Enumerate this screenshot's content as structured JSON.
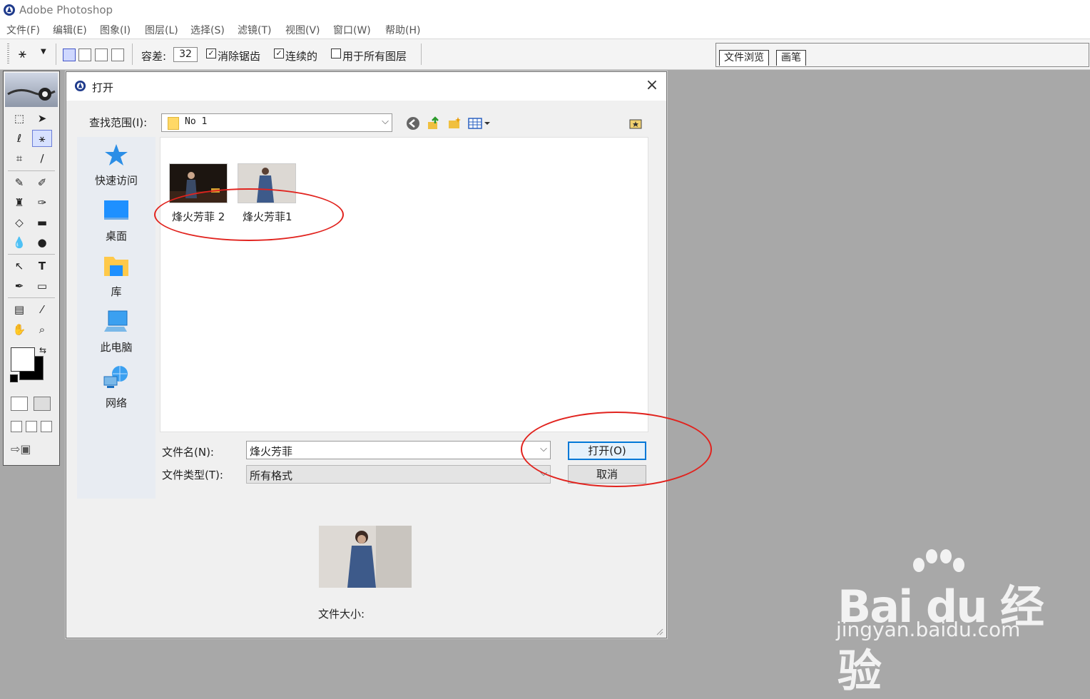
{
  "app": {
    "title": "Adobe Photoshop"
  },
  "menu": [
    {
      "label": "文件(F)"
    },
    {
      "label": "编辑(E)"
    },
    {
      "label": "图象(I)"
    },
    {
      "label": "图层(L)"
    },
    {
      "label": "选择(S)"
    },
    {
      "label": "滤镜(T)"
    },
    {
      "label": "视图(V)"
    },
    {
      "label": "窗口(W)"
    },
    {
      "label": "帮助(H)"
    }
  ],
  "options": {
    "tolerance_label": "容差:",
    "tolerance_value": "32",
    "antialias_label": "消除锯齿",
    "antialias_checked": true,
    "contiguous_label": "连续的",
    "contiguous_checked": true,
    "all_layers_label": "用于所有图层",
    "all_layers_checked": false
  },
  "palette_tabs": [
    {
      "label": "文件浏览"
    },
    {
      "label": "画笔"
    }
  ],
  "dialog": {
    "title": "打开",
    "lookin_label": "查找范围(I):",
    "lookin_value": "No 1",
    "places": [
      {
        "label": "快速访问",
        "icon": "star-icon"
      },
      {
        "label": "桌面",
        "icon": "desktop-icon"
      },
      {
        "label": "库",
        "icon": "library-folder-icon"
      },
      {
        "label": "此电脑",
        "icon": "computer-icon"
      },
      {
        "label": "网络",
        "icon": "network-icon"
      }
    ],
    "files": [
      {
        "name": "烽火芳菲 2"
      },
      {
        "name": "烽火芳菲1"
      }
    ],
    "filename_label": "文件名(N):",
    "filename_value": "烽火芳菲",
    "filetype_label": "文件类型(T):",
    "filetype_value": "所有格式",
    "open_button": "打开(O)",
    "cancel_button": "取消",
    "filesize_label": "文件大小:"
  },
  "watermark": {
    "brand": "Bai du 经验",
    "url": "jingyan.baidu.com"
  },
  "colors": {
    "annotation": "#e1231e",
    "accent": "#0078d7"
  }
}
